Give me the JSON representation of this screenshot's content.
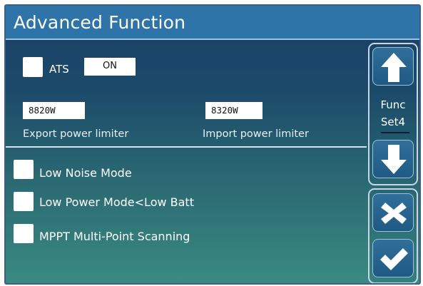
{
  "header": {
    "title": "Advanced Function"
  },
  "ats": {
    "label": "ATS",
    "value": "ON"
  },
  "export_limiter": {
    "value": "8820W",
    "label": "Export power limiter"
  },
  "import_limiter": {
    "value": "8320W",
    "label": "Import power limiter"
  },
  "options": [
    {
      "label": "Low Noise Mode"
    },
    {
      "label": "Low Power Mode<Low Batt"
    },
    {
      "label": "MPPT Multi-Point Scanning"
    }
  ],
  "nav": {
    "func_line1": "Func",
    "func_line2": "Set4"
  },
  "icons": {
    "up": "arrow-up-icon",
    "down": "arrow-down-icon",
    "cancel": "close-icon",
    "confirm": "check-icon"
  },
  "colors": {
    "title_bar": "#2f74a9",
    "background_top": "#1a3d64",
    "background_bottom": "#3a8a82",
    "button": "#1f5a82"
  }
}
